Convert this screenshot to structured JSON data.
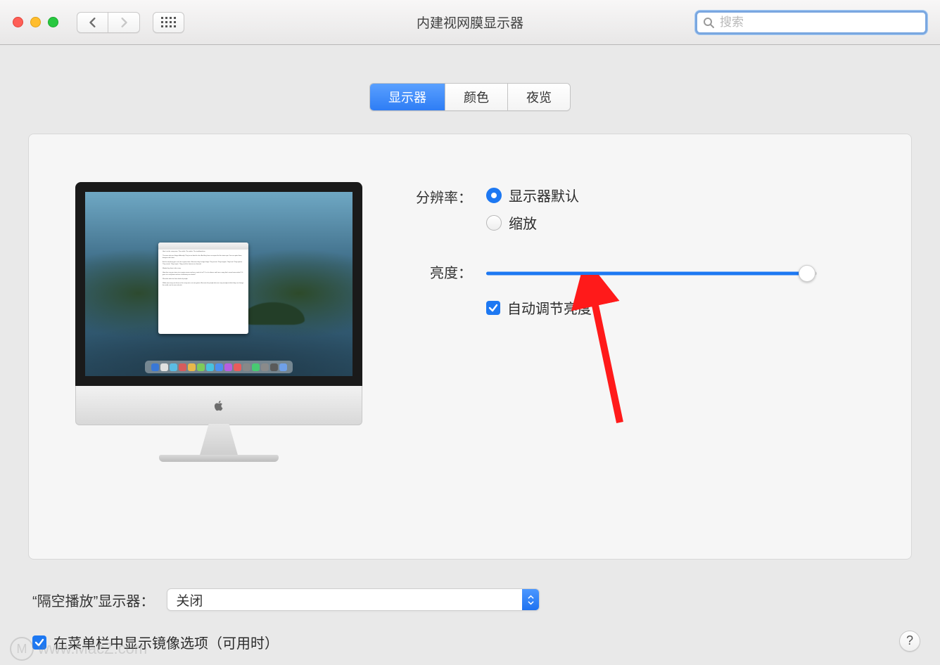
{
  "window": {
    "title": "内建视网膜显示器"
  },
  "search": {
    "placeholder": "搜索"
  },
  "tabs": [
    {
      "label": "显示器",
      "selected": true
    },
    {
      "label": "颜色",
      "selected": false
    },
    {
      "label": "夜览",
      "selected": false
    }
  ],
  "settings": {
    "resolution": {
      "label": "分辨率：",
      "options": [
        {
          "label": "显示器默认",
          "selected": true
        },
        {
          "label": "缩放",
          "selected": false
        }
      ]
    },
    "brightness": {
      "label": "亮度：",
      "value_pct": 97
    },
    "auto_brightness": {
      "label": "自动调节亮度",
      "checked": true
    }
  },
  "airplay": {
    "label": "“隔空播放”显示器：",
    "value": "关闭"
  },
  "mirror_checkbox": {
    "label": "在菜单栏中显示镜像选项（可用时）",
    "checked": true
  },
  "help_button": {
    "label": "?"
  },
  "watermark": {
    "text": "www.MacZ.com",
    "logo": "M"
  },
  "colors": {
    "accent": "#1d78f2"
  }
}
